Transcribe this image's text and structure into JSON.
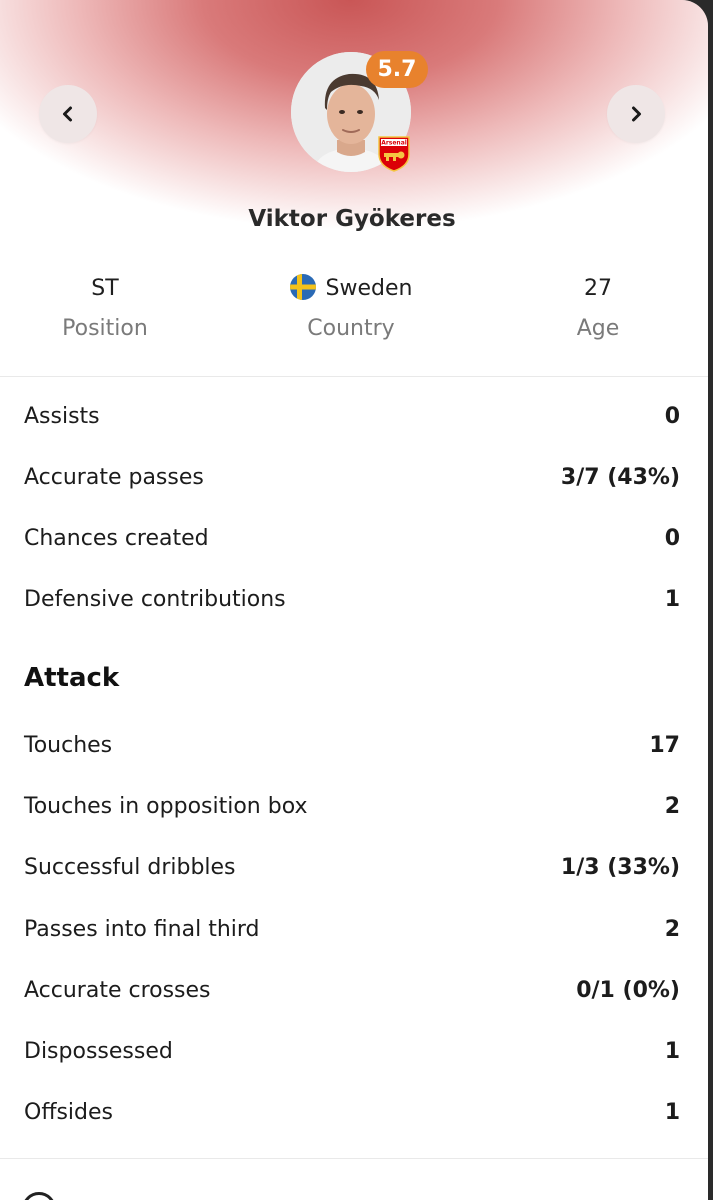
{
  "player": {
    "name": "Viktor Gyökeres",
    "rating": "5.7",
    "club_badge_text": "Arsenal",
    "photo_icon": "player-portrait",
    "info": {
      "position_value": "ST",
      "position_label": "Position",
      "country_value": "Sweden",
      "country_label": "Country",
      "age_value": "27",
      "age_label": "Age"
    }
  },
  "nav": {
    "prev_icon": "chevron-left-icon",
    "next_icon": "chevron-right-icon"
  },
  "stats": [
    {
      "label": "Assists",
      "value": "0"
    },
    {
      "label": "Accurate passes",
      "value": "3/7 (43%)"
    },
    {
      "label": "Chances created",
      "value": "0"
    },
    {
      "label": "Defensive contributions",
      "value": "1"
    }
  ],
  "attack": {
    "title": "Attack",
    "rows": [
      {
        "label": "Touches",
        "value": "17"
      },
      {
        "label": "Touches in opposition box",
        "value": "2"
      },
      {
        "label": "Successful dribbles",
        "value": "1/3 (33%)"
      },
      {
        "label": "Passes into final third",
        "value": "2"
      },
      {
        "label": "Accurate crosses",
        "value": "0/1 (0%)"
      },
      {
        "label": "Dispossessed",
        "value": "1"
      },
      {
        "label": "Offsides",
        "value": "1"
      }
    ]
  },
  "colors": {
    "rating_badge": "#e8822d",
    "hero_gradient": "#c95656",
    "club_red": "#db0007"
  }
}
